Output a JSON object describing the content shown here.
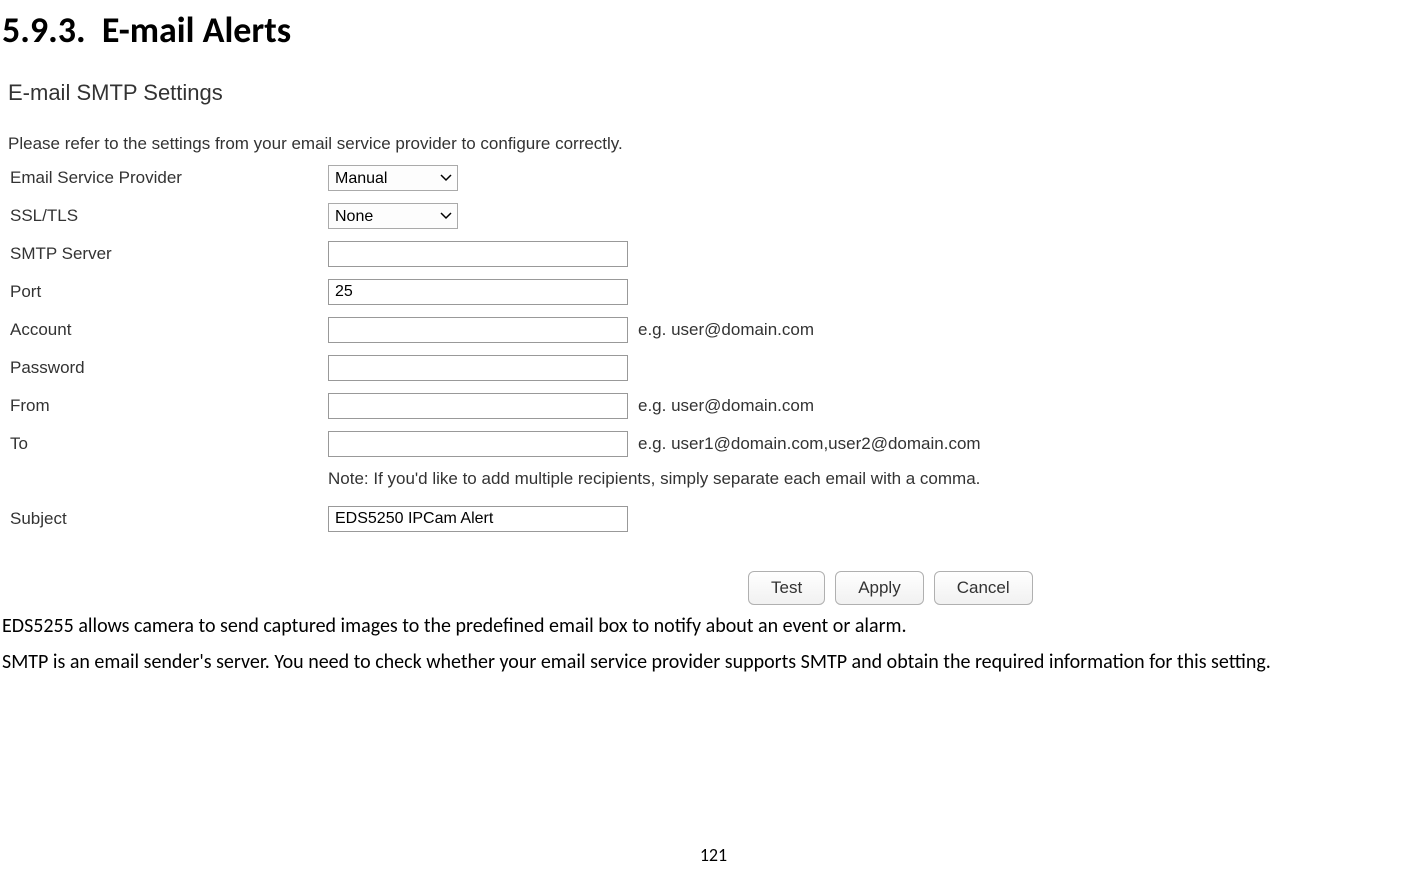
{
  "section": {
    "number": "5.9.3.",
    "title": "E-mail Alerts"
  },
  "panel": {
    "title": "E-mail SMTP Settings",
    "intro": "Please refer to the settings from your email service provider to configure correctly.",
    "fields": {
      "provider": {
        "label": "Email Service Provider",
        "value": "Manual"
      },
      "ssltls": {
        "label": "SSL/TLS",
        "value": "None"
      },
      "smtp": {
        "label": "SMTP Server",
        "value": ""
      },
      "port": {
        "label": "Port",
        "value": "25"
      },
      "account": {
        "label": "Account",
        "value": "",
        "hint": "e.g. user@domain.com"
      },
      "password": {
        "label": "Password",
        "value": ""
      },
      "from": {
        "label": "From",
        "value": "",
        "hint": "e.g. user@domain.com"
      },
      "to": {
        "label": "To",
        "value": "",
        "hint": "e.g. user1@domain.com,user2@domain.com"
      },
      "note": "Note: If you'd like to add multiple recipients, simply separate each email with a comma.",
      "subject": {
        "label": "Subject",
        "value": "EDS5250 IPCam Alert"
      }
    },
    "buttons": {
      "test": "Test",
      "apply": "Apply",
      "cancel": "Cancel"
    }
  },
  "body": {
    "p1": "EDS5255 allows camera to send captured images to the predefined email box to notify about an event or alarm.",
    "p2": "SMTP is an email sender's server. You need to check whether your email service provider supports SMTP and obtain the required information for this setting."
  },
  "page_number": "121"
}
